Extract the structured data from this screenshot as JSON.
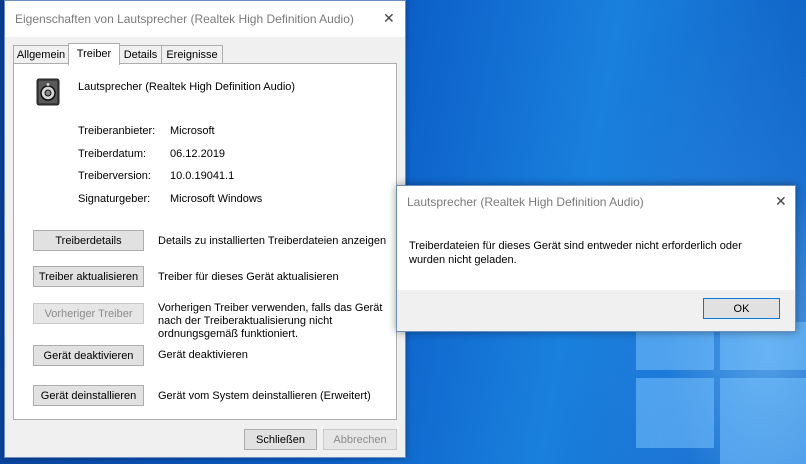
{
  "properties_window": {
    "title": "Eigenschaften von Lautsprecher (Realtek High Definition Audio)",
    "tabs": [
      "Allgemein",
      "Treiber",
      "Details",
      "Ereignisse"
    ],
    "active_tab": "Treiber",
    "device_name": "Lautsprecher (Realtek High Definition Audio)",
    "fields": [
      {
        "label": "Treiberanbieter:",
        "value": "Microsoft"
      },
      {
        "label": "Treiberdatum:",
        "value": "06.12.2019"
      },
      {
        "label": "Treiberversion:",
        "value": "10.0.19041.1"
      },
      {
        "label": "Signaturgeber:",
        "value": "Microsoft Windows"
      }
    ],
    "actions": [
      {
        "button": "Treiberdetails",
        "description": "Details zu installierten Treiberdateien anzeigen",
        "enabled": true
      },
      {
        "button": "Treiber aktualisieren",
        "description": "Treiber für dieses Gerät aktualisieren",
        "enabled": true
      },
      {
        "button": "Vorheriger Treiber",
        "description": "Vorherigen Treiber verwenden, falls das Gerät nach der Treiberaktualisierung nicht ordnungsgemäß funktioniert.",
        "enabled": false
      },
      {
        "button": "Gerät deaktivieren",
        "description": "Gerät deaktivieren",
        "enabled": true
      },
      {
        "button": "Gerät deinstallieren",
        "description": "Gerät vom System deinstallieren (Erweitert)",
        "enabled": true
      }
    ],
    "close_button": "Schließen",
    "cancel_button": "Abbrechen"
  },
  "message_dialog": {
    "title": "Lautsprecher (Realtek High Definition Audio)",
    "message": "Treiberdateien für dieses Gerät sind entweder nicht erforderlich oder wurden nicht geladen.",
    "ok_button": "OK"
  },
  "icons": {
    "close": "close-icon",
    "device": "speaker-icon"
  },
  "colors": {
    "desktop": "#0b5ec7",
    "dialog_border": "#6d8fbe",
    "ok_button_border": "#0078d7"
  }
}
